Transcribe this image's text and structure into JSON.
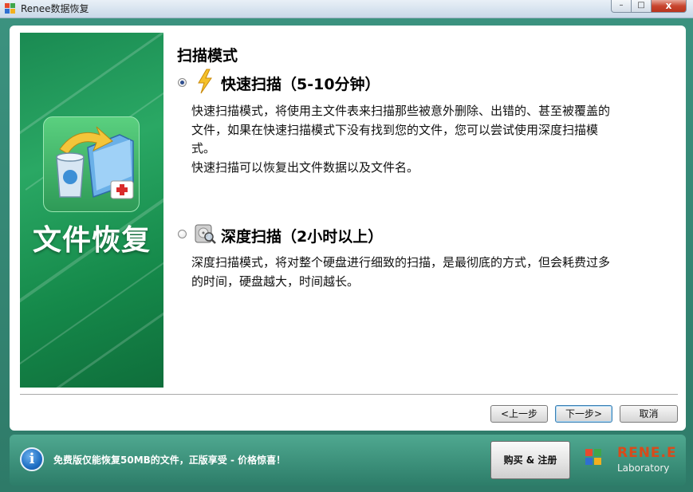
{
  "window": {
    "title": "Renee数据恢复",
    "minimize_glyph": "–",
    "maximize_glyph": "□",
    "close_glyph": "x"
  },
  "banner": {
    "title": "文件恢复",
    "icon": "recycle-bin-recovery-icon"
  },
  "scan": {
    "heading": "扫描模式",
    "options": [
      {
        "title": "快速扫描（5-10分钟）",
        "selected": true,
        "icon": "lightning-icon",
        "description": [
          "快速扫描模式，将使用主文件表来扫描那些被意外删除、出错的、甚至被覆盖的",
          "文件，如果在快速扫描模式下没有找到您的文件，您可以尝试使用深度扫描模",
          "式。",
          "快速扫描可以恢复出文件数据以及文件名。"
        ]
      },
      {
        "title": "深度扫描（2小时以上）",
        "selected": false,
        "icon": "hard-disk-magnifier-icon",
        "description": [
          "深度扫描模式，将对整个硬盘进行细致的扫描，是最彻底的方式，但会耗费过多",
          "的时间，硬盘越大，时间越长。"
        ]
      }
    ]
  },
  "nav": {
    "prev_label": "<上一步",
    "next_label": "下一步>",
    "cancel_label": "取消"
  },
  "footer": {
    "notice": "免费版仅能恢复50MB的文件，正版享受 - 价格惊喜！",
    "buy_label": "购买 & 注册",
    "brand": "RENE.E",
    "brand_sub": "Laboratory"
  },
  "colors": {
    "banner_green": "#1a8a52",
    "footer_teal": "#2d7d69",
    "brand_orange": "#d94a1a",
    "radio_dot": "#2f4f8f"
  }
}
